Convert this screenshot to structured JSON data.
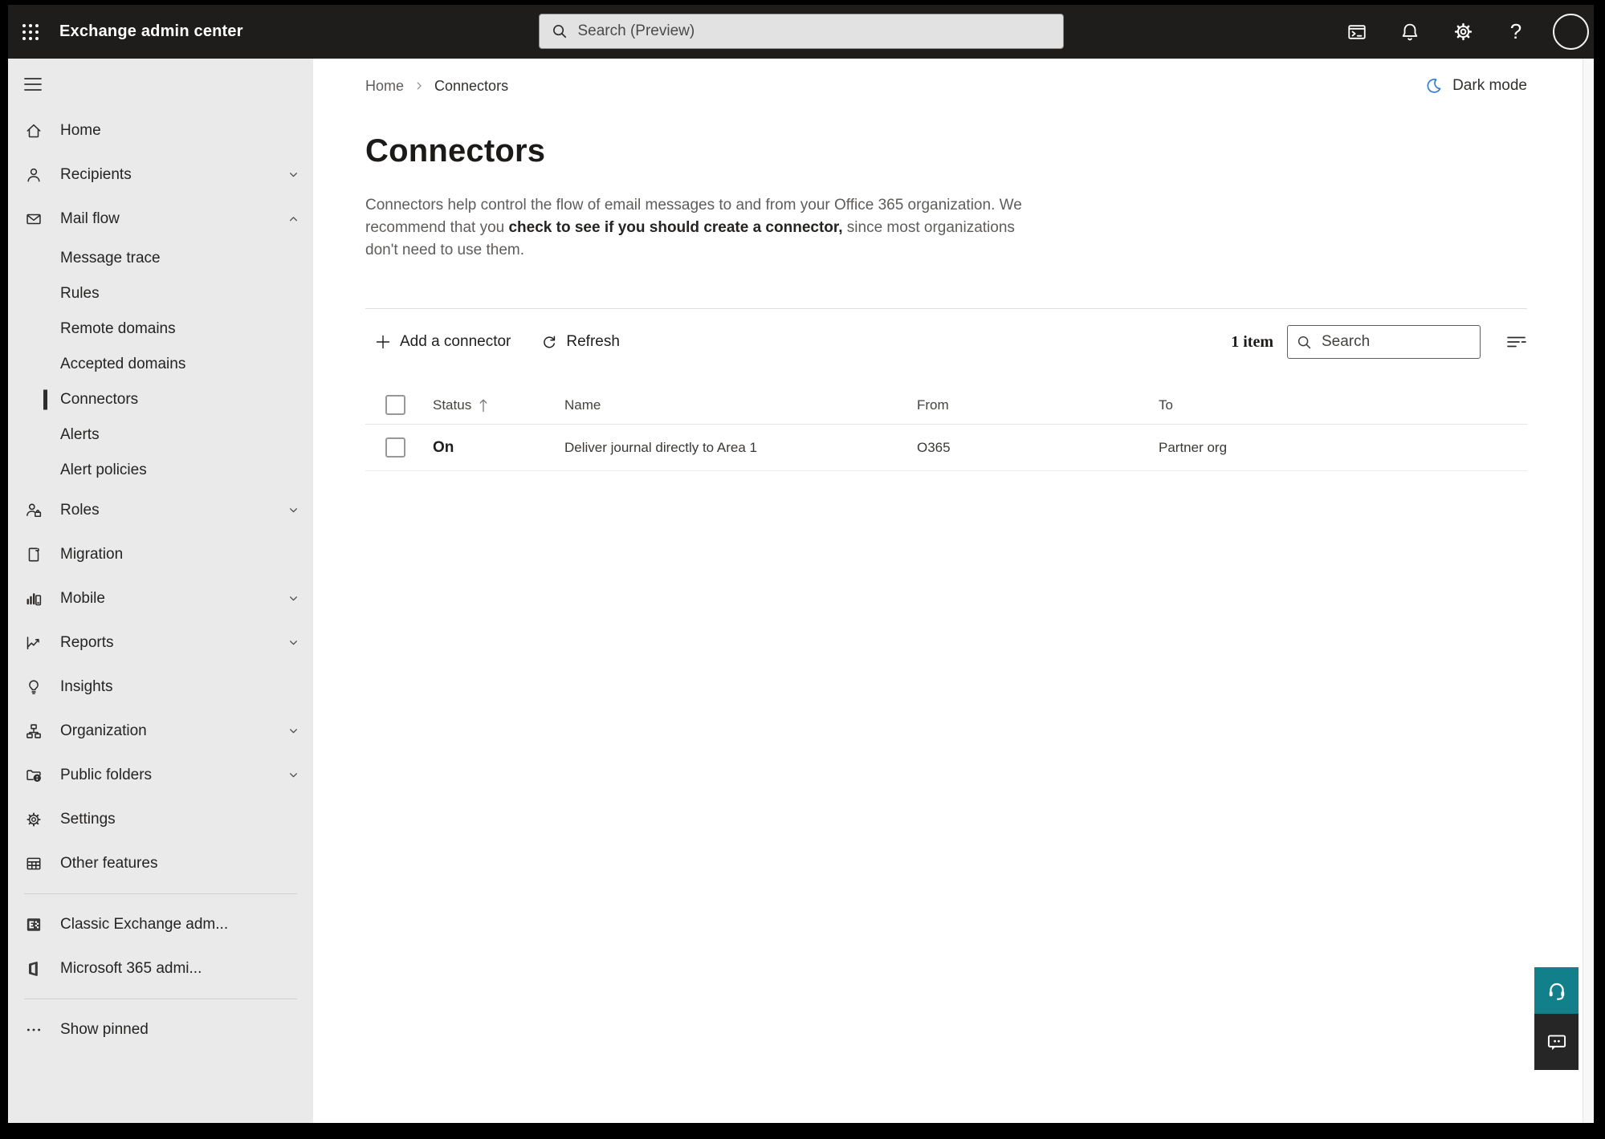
{
  "topbar": {
    "app_title": "Exchange admin center",
    "search_placeholder": "Search (Preview)"
  },
  "page_header": {
    "breadcrumb_home": "Home",
    "breadcrumb_current": "Connectors",
    "dark_mode_label": "Dark mode",
    "title": "Connectors",
    "description_prefix": "Connectors help control the flow of email messages to and from your Office 365 organization. We recommend that you ",
    "description_link": "check to see if you should create a connector,",
    "description_suffix": " since most organizations don't need to use them."
  },
  "toolbar": {
    "add_connector_label": "Add a connector",
    "refresh_label": "Refresh",
    "item_count": "1 item",
    "search_placeholder": "Search"
  },
  "table": {
    "headers": {
      "status": "Status",
      "name": "Name",
      "from": "From",
      "to": "To"
    },
    "rows": [
      {
        "status": "On",
        "name": "Deliver journal directly to Area 1",
        "from": "O365",
        "to": "Partner org"
      }
    ]
  },
  "sidebar": {
    "items": [
      {
        "label": "Home"
      },
      {
        "label": "Recipients"
      },
      {
        "label": "Mail flow"
      },
      {
        "label": "Message trace"
      },
      {
        "label": "Rules"
      },
      {
        "label": "Remote domains"
      },
      {
        "label": "Accepted domains"
      },
      {
        "label": "Connectors"
      },
      {
        "label": "Alerts"
      },
      {
        "label": "Alert policies"
      },
      {
        "label": "Roles"
      },
      {
        "label": "Migration"
      },
      {
        "label": "Mobile"
      },
      {
        "label": "Reports"
      },
      {
        "label": "Insights"
      },
      {
        "label": "Organization"
      },
      {
        "label": "Public folders"
      },
      {
        "label": "Settings"
      },
      {
        "label": "Other features"
      },
      {
        "label": "Classic Exchange adm..."
      },
      {
        "label": "Microsoft 365 admi..."
      },
      {
        "label": "Show pinned"
      }
    ]
  },
  "colors": {
    "topbar_bg": "#1e1d1c",
    "sidebar_bg": "#eaeaea",
    "help_teal": "#12808a",
    "dark_mode_icon_blue": "#2b7cd3"
  }
}
